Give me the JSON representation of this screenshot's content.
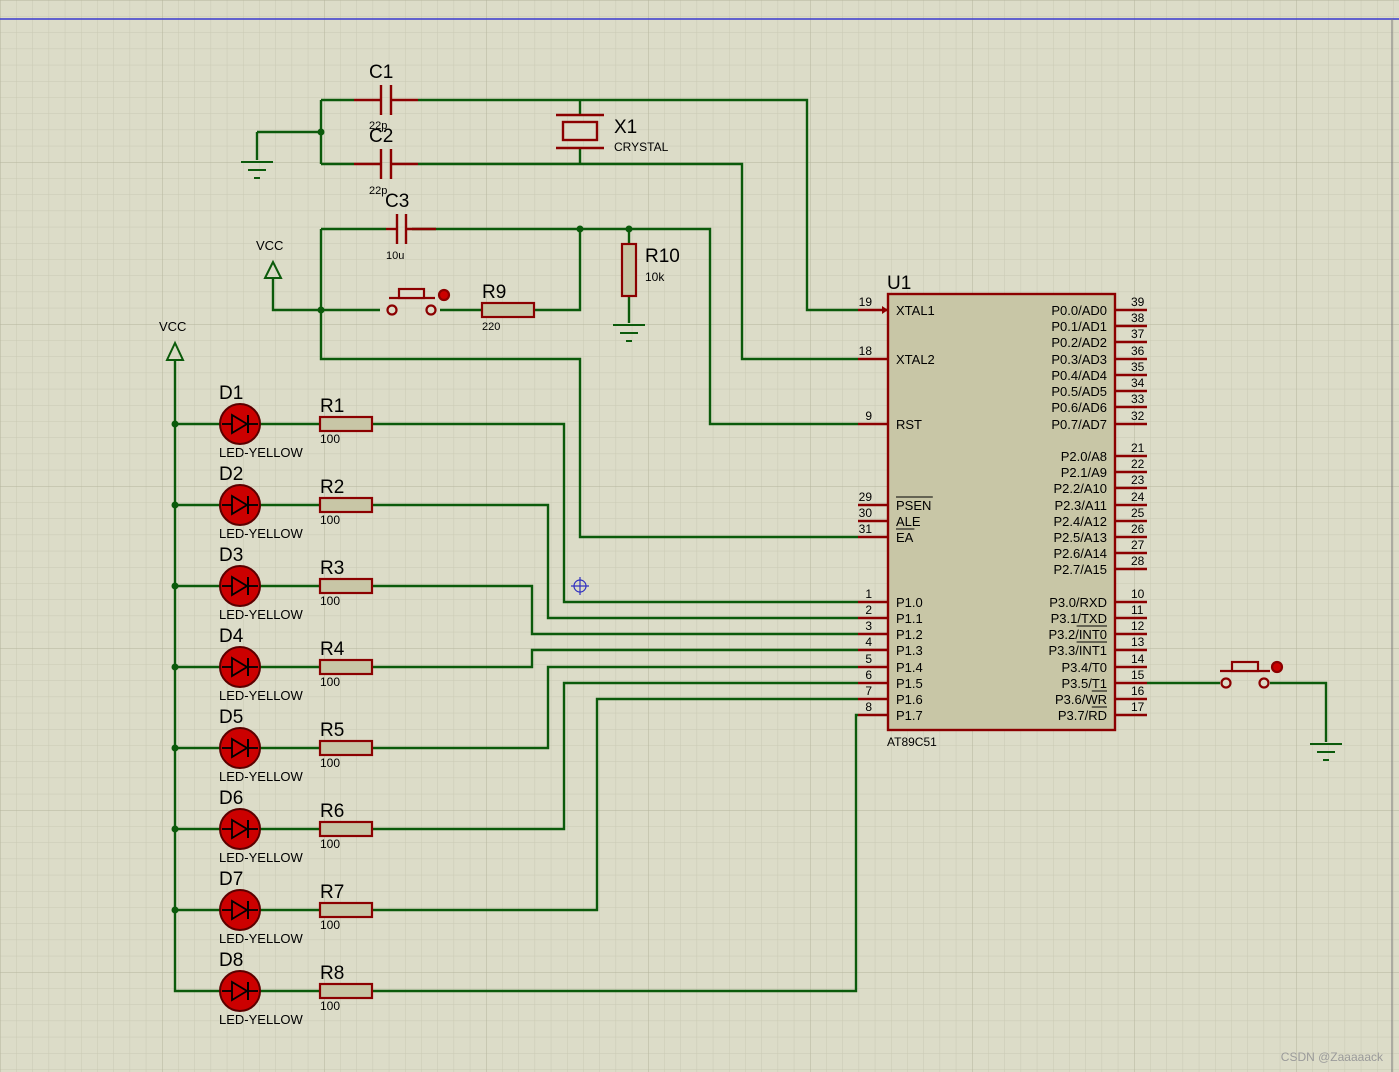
{
  "colors": {
    "background": "#dcdcc8",
    "grid_minor": "#c9c9b3",
    "grid_major": "#b4b49c",
    "wire": "#0b5a0b",
    "component": "#8b0000",
    "chip_fill": "#c8c6a6",
    "led_fill": "#cc0000",
    "top_line": "#3a3ad0",
    "text": "#000000"
  },
  "components": {
    "C1": {
      "ref": "C1",
      "value": "22p"
    },
    "C2": {
      "ref": "C2",
      "value": "22p"
    },
    "C3": {
      "ref": "C3",
      "value": "10u"
    },
    "X1": {
      "ref": "X1",
      "value": "CRYSTAL"
    },
    "R9": {
      "ref": "R9",
      "value": "220"
    },
    "R10": {
      "ref": "R10",
      "value": "10k"
    },
    "vcc_labels": [
      "VCC",
      "VCC"
    ],
    "leds": [
      {
        "ref": "D1",
        "type": "LED-YELLOW"
      },
      {
        "ref": "D2",
        "type": "LED-YELLOW"
      },
      {
        "ref": "D3",
        "type": "LED-YELLOW"
      },
      {
        "ref": "D4",
        "type": "LED-YELLOW"
      },
      {
        "ref": "D5",
        "type": "LED-YELLOW"
      },
      {
        "ref": "D6",
        "type": "LED-YELLOW"
      },
      {
        "ref": "D7",
        "type": "LED-YELLOW"
      },
      {
        "ref": "D8",
        "type": "LED-YELLOW"
      }
    ],
    "resistors": [
      {
        "ref": "R1",
        "value": "100"
      },
      {
        "ref": "R2",
        "value": "100"
      },
      {
        "ref": "R3",
        "value": "100"
      },
      {
        "ref": "R4",
        "value": "100"
      },
      {
        "ref": "R5",
        "value": "100"
      },
      {
        "ref": "R6",
        "value": "100"
      },
      {
        "ref": "R7",
        "value": "100"
      },
      {
        "ref": "R8",
        "value": "100"
      }
    ]
  },
  "chip": {
    "ref": "U1",
    "part": "AT89C51",
    "left_pins": [
      {
        "num": "19",
        "name": "XTAL1"
      },
      {
        "num": "18",
        "name": "XTAL2"
      },
      {
        "num": "9",
        "name": "RST"
      },
      {
        "num": "29",
        "name": "PSEN"
      },
      {
        "num": "30",
        "name": "ALE"
      },
      {
        "num": "31",
        "name": "EA"
      },
      {
        "num": "1",
        "name": "P1.0"
      },
      {
        "num": "2",
        "name": "P1.1"
      },
      {
        "num": "3",
        "name": "P1.2"
      },
      {
        "num": "4",
        "name": "P1.3"
      },
      {
        "num": "5",
        "name": "P1.4"
      },
      {
        "num": "6",
        "name": "P1.5"
      },
      {
        "num": "7",
        "name": "P1.6"
      },
      {
        "num": "8",
        "name": "P1.7"
      }
    ],
    "right_pins": [
      {
        "num": "39",
        "name": "P0.0/AD0"
      },
      {
        "num": "38",
        "name": "P0.1/AD1"
      },
      {
        "num": "37",
        "name": "P0.2/AD2"
      },
      {
        "num": "36",
        "name": "P0.3/AD3"
      },
      {
        "num": "35",
        "name": "P0.4/AD4"
      },
      {
        "num": "34",
        "name": "P0.5/AD5"
      },
      {
        "num": "33",
        "name": "P0.6/AD6"
      },
      {
        "num": "32",
        "name": "P0.7/AD7"
      },
      {
        "num": "21",
        "name": "P2.0/A8"
      },
      {
        "num": "22",
        "name": "P2.1/A9"
      },
      {
        "num": "23",
        "name": "P2.2/A10"
      },
      {
        "num": "24",
        "name": "P2.3/A11"
      },
      {
        "num": "25",
        "name": "P2.4/A12"
      },
      {
        "num": "26",
        "name": "P2.5/A13"
      },
      {
        "num": "27",
        "name": "P2.6/A14"
      },
      {
        "num": "28",
        "name": "P2.7/A15"
      },
      {
        "num": "10",
        "name": "P3.0/RXD"
      },
      {
        "num": "11",
        "name": "P3.1/TXD"
      },
      {
        "num": "12",
        "name": "P3.2/INT0"
      },
      {
        "num": "13",
        "name": "P3.3/INT1"
      },
      {
        "num": "14",
        "name": "P3.4/T0"
      },
      {
        "num": "15",
        "name": "P3.5/T1"
      },
      {
        "num": "16",
        "name": "P3.6/WR"
      },
      {
        "num": "17",
        "name": "P3.7/RD"
      }
    ]
  },
  "watermark": "CSDN @Zaaaaack"
}
